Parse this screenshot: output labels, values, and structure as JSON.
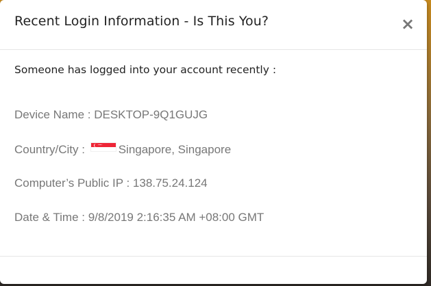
{
  "dialog": {
    "title": "Recent Login Information - Is This You?",
    "close_label": "×",
    "lead": "Someone has logged into your account recently :",
    "device": {
      "label": "Device Name : ",
      "value": "DESKTOP-9Q1GUJG"
    },
    "country": {
      "label": "Country/City : ",
      "flag_icon": "singapore-flag-icon",
      "value": "Singapore, Singapore"
    },
    "ip": {
      "label": "Computer’s Public IP : ",
      "value": "138.75.24.124"
    },
    "date": {
      "label": "Date & Time : ",
      "value": "9/8/2019 2:16:35 AM +08:00 GMT"
    }
  },
  "colors": {
    "flag_red": "#ee2536",
    "text_dark": "#222222",
    "text_muted": "#777777",
    "divider": "#e5e5e5"
  }
}
